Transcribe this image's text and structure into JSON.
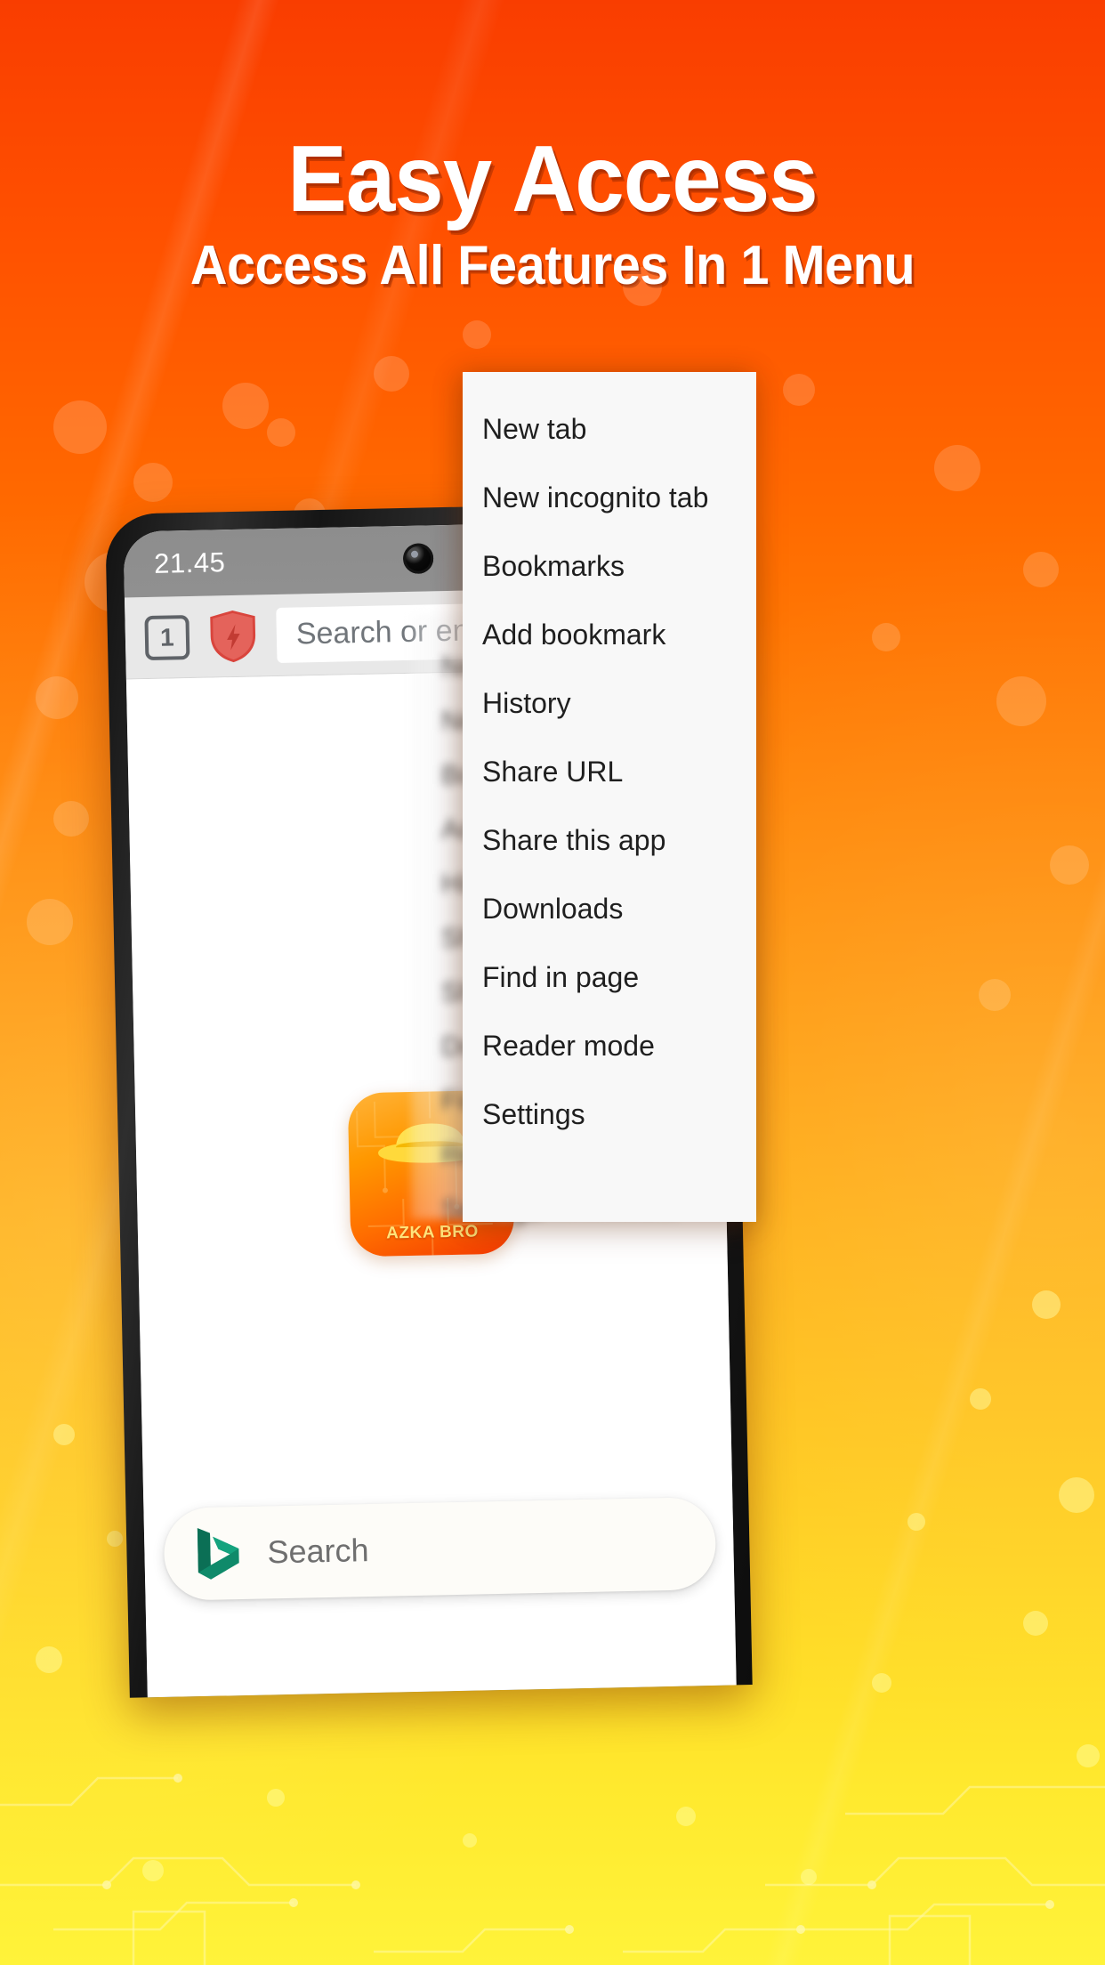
{
  "promo": {
    "title": "Easy Access",
    "subtitle": "Access All Features In 1 Menu",
    "bg_top_color": "#f93d00",
    "bg_bottom_color": "#fff33a",
    "title_color": "#ffffff"
  },
  "phone": {
    "status_bar": {
      "clock": "21.45"
    },
    "browser_toolbar": {
      "tab_count": "1",
      "shield_icon": "shield-bolt-icon",
      "shield_color": "#e0524a",
      "url_placeholder": "Search or enter URL"
    },
    "page": {
      "app_icon_label": "AZKA BRO",
      "app_icon_accent": "#ff6d00"
    },
    "bottom_search": {
      "logo_icon": "bing-b-icon",
      "logo_color": "#0f8a6a",
      "label": "Search"
    }
  },
  "menu": {
    "items": [
      {
        "label": "New tab",
        "icon": "new-tab-icon"
      },
      {
        "label": "New incognito tab",
        "icon": "incognito-icon"
      },
      {
        "label": "Bookmarks",
        "icon": "bookmarks-icon"
      },
      {
        "label": "Add bookmark",
        "icon": "add-bookmark-icon"
      },
      {
        "label": "History",
        "icon": "history-icon"
      },
      {
        "label": "Share URL",
        "icon": "share-url-icon"
      },
      {
        "label": "Share this app",
        "icon": "share-app-icon"
      },
      {
        "label": "Downloads",
        "icon": "downloads-icon"
      },
      {
        "label": "Find in page",
        "icon": "find-in-page-icon"
      },
      {
        "label": "Reader mode",
        "icon": "reader-mode-icon"
      },
      {
        "label": "Settings",
        "icon": "settings-icon"
      }
    ]
  },
  "ghost_menu": {
    "items": [
      {
        "label": "New tab"
      },
      {
        "label": "New incognito tab"
      },
      {
        "label": "Bookmarks"
      },
      {
        "label": "Add bookmark"
      },
      {
        "label": "History"
      },
      {
        "label": "Share URL"
      },
      {
        "label": "Share this app"
      },
      {
        "label": "Downloads"
      },
      {
        "label": "Find in page"
      },
      {
        "label": "Reader mode"
      },
      {
        "label": "Settings"
      }
    ]
  }
}
